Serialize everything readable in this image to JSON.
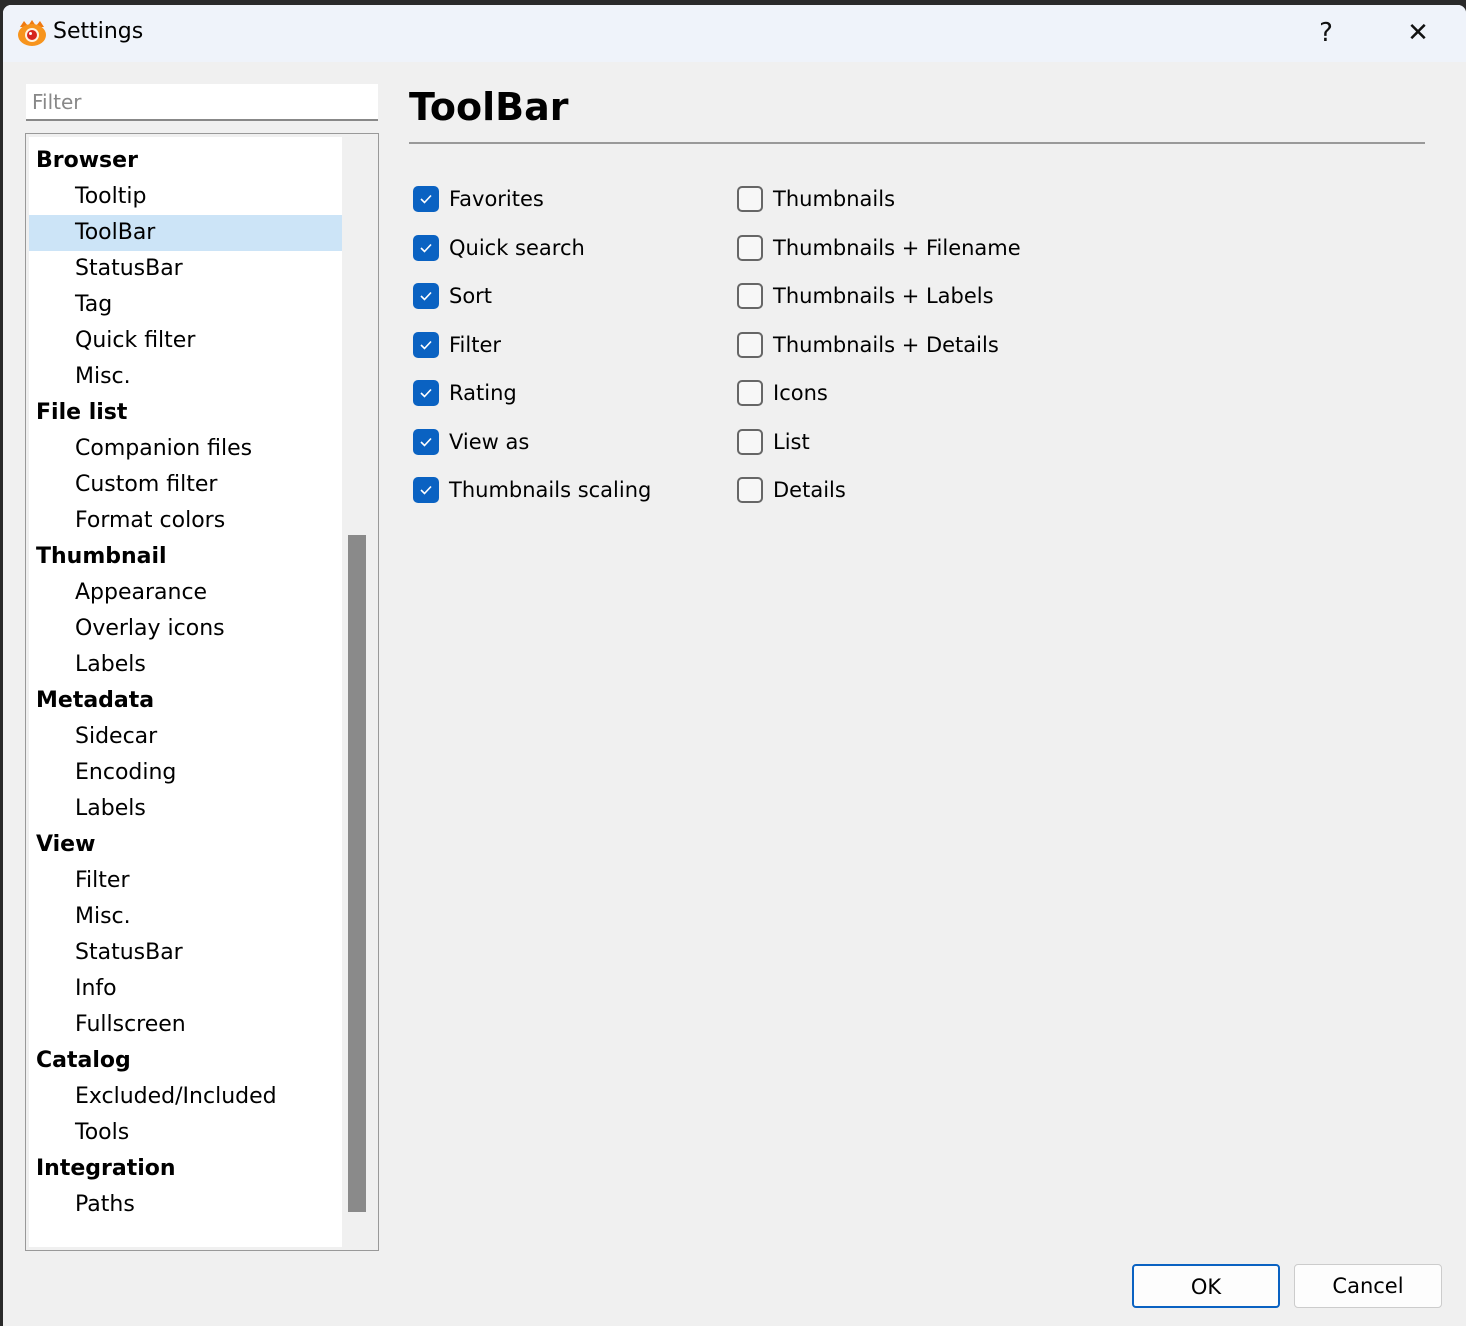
{
  "window": {
    "title": "Settings",
    "help": "?",
    "close": "✕"
  },
  "filter": {
    "placeholder": "Filter"
  },
  "tree": [
    {
      "label": "Browser",
      "type": "h"
    },
    {
      "label": "Tooltip",
      "type": "c"
    },
    {
      "label": "ToolBar",
      "type": "c",
      "selected": true
    },
    {
      "label": "StatusBar",
      "type": "c"
    },
    {
      "label": "Tag",
      "type": "c"
    },
    {
      "label": "Quick filter",
      "type": "c"
    },
    {
      "label": "Misc.",
      "type": "c"
    },
    {
      "label": "File list",
      "type": "h"
    },
    {
      "label": "Companion files",
      "type": "c"
    },
    {
      "label": "Custom filter",
      "type": "c"
    },
    {
      "label": "Format colors",
      "type": "c"
    },
    {
      "label": "Thumbnail",
      "type": "h"
    },
    {
      "label": "Appearance",
      "type": "c"
    },
    {
      "label": "Overlay icons",
      "type": "c"
    },
    {
      "label": "Labels",
      "type": "c"
    },
    {
      "label": "Metadata",
      "type": "h"
    },
    {
      "label": "Sidecar",
      "type": "c"
    },
    {
      "label": "Encoding",
      "type": "c"
    },
    {
      "label": "Labels",
      "type": "c"
    },
    {
      "label": "View",
      "type": "h"
    },
    {
      "label": "Filter",
      "type": "c"
    },
    {
      "label": "Misc.",
      "type": "c"
    },
    {
      "label": "StatusBar",
      "type": "c"
    },
    {
      "label": "Info",
      "type": "c"
    },
    {
      "label": "Fullscreen",
      "type": "c"
    },
    {
      "label": "Catalog",
      "type": "h"
    },
    {
      "label": "Excluded/Included",
      "type": "c"
    },
    {
      "label": "Tools",
      "type": "c"
    },
    {
      "label": "Integration",
      "type": "h"
    },
    {
      "label": "Paths",
      "type": "c"
    }
  ],
  "page": {
    "heading": "ToolBar"
  },
  "left_checks": [
    {
      "label": "Favorites",
      "checked": true
    },
    {
      "label": "Quick search",
      "checked": true
    },
    {
      "label": "Sort",
      "checked": true
    },
    {
      "label": "Filter",
      "checked": true
    },
    {
      "label": "Rating",
      "checked": true
    },
    {
      "label": "View as",
      "checked": true
    },
    {
      "label": "Thumbnails scaling",
      "checked": true
    }
  ],
  "right_checks": [
    {
      "label": "Thumbnails",
      "checked": false
    },
    {
      "label": "Thumbnails + Filename",
      "checked": false
    },
    {
      "label": "Thumbnails + Labels",
      "checked": false
    },
    {
      "label": "Thumbnails + Details",
      "checked": false
    },
    {
      "label": "Icons",
      "checked": false
    },
    {
      "label": "List",
      "checked": false
    },
    {
      "label": "Details",
      "checked": false
    }
  ],
  "buttons": {
    "ok": "OK",
    "cancel": "Cancel"
  },
  "colors": {
    "accent": "#0a62c2",
    "selection": "#cce4f7"
  }
}
